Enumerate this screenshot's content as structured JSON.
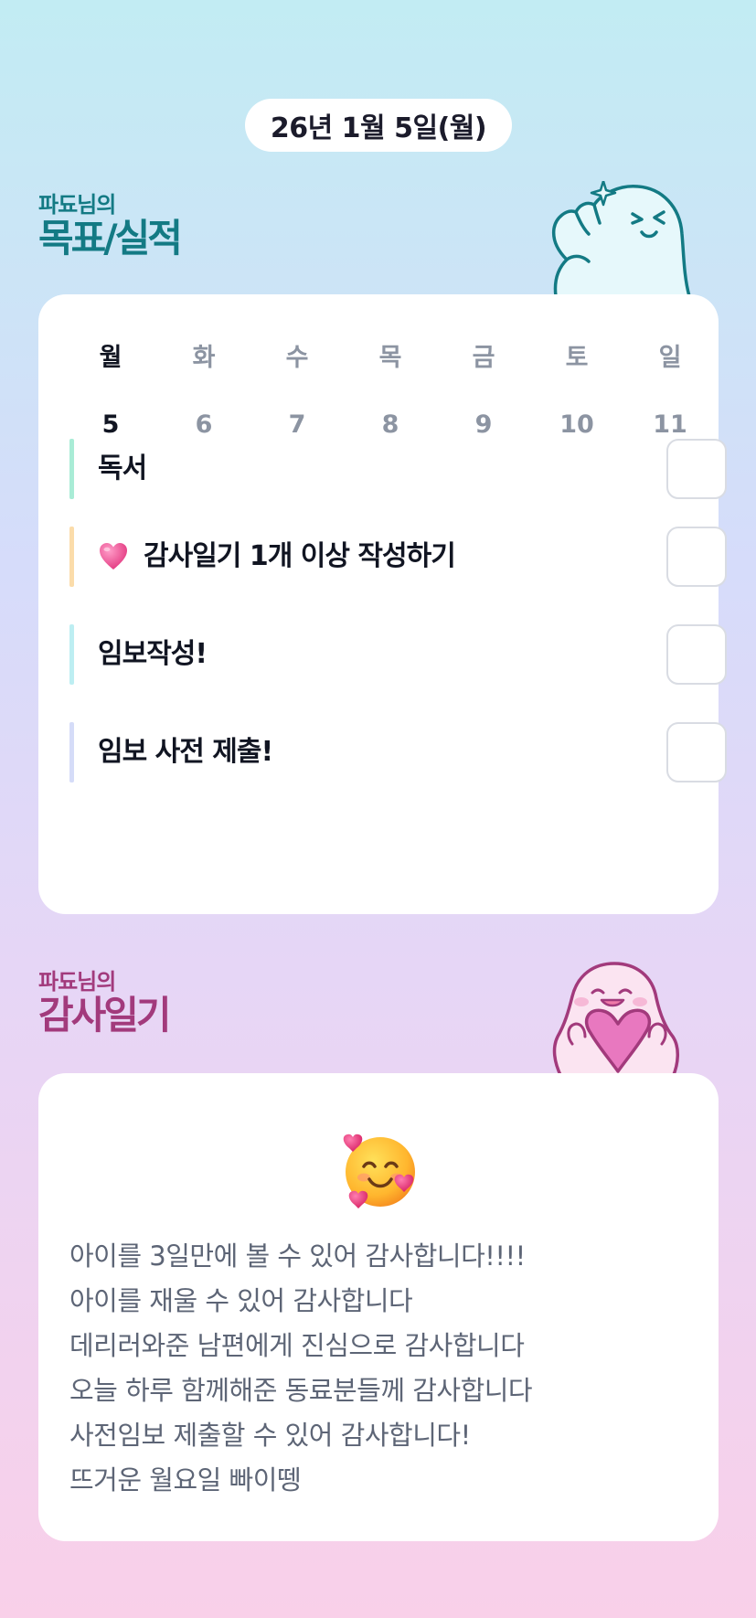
{
  "date": "26년 1월 5일(월)",
  "goal_section": {
    "owner": "파됴님의",
    "title": "목표/실적"
  },
  "week": {
    "days": [
      {
        "weekday": "월",
        "day": "5",
        "active": true
      },
      {
        "weekday": "화",
        "day": "6",
        "active": false
      },
      {
        "weekday": "수",
        "day": "7",
        "active": false
      },
      {
        "weekday": "목",
        "day": "8",
        "active": false
      },
      {
        "weekday": "금",
        "day": "9",
        "active": false
      },
      {
        "weekday": "토",
        "day": "10",
        "active": false
      },
      {
        "weekday": "일",
        "day": "11",
        "active": false
      }
    ]
  },
  "goals": [
    {
      "label": "독서",
      "bar_color": "#a9ecd6",
      "icon": null,
      "checked": false
    },
    {
      "label": "감사일기 1개 이상 작성하기",
      "bar_color": "#fbdcaa",
      "icon": "pink-heart-icon",
      "checked": false
    },
    {
      "label": "임보작성!",
      "bar_color": "#bdeef2",
      "icon": null,
      "checked": false
    },
    {
      "label": "임보 사전 제출!",
      "bar_color": "#d5dcf8",
      "icon": null,
      "checked": false
    }
  ],
  "thanks_section": {
    "owner": "파됴님의",
    "title": "감사일기"
  },
  "thanks_emoji": "smiling-face-with-hearts-icon",
  "thanks_lines": [
    "아이를 3일만에 볼 수 있어 감사합니다!!!!",
    "아이를 재울 수 있어 감사합니다",
    "데리러와준 남편에게 진심으로 감사합니다",
    "오늘 하루 함께해준 동료분들께 감사합니다",
    "사전임보 제출할 수 있어 감사합니다!",
    "뜨거운 월요일 빠이뗑"
  ],
  "colors": {
    "goal_accent": "#137a84",
    "thanks_accent": "#a23a7c",
    "text_dark": "#111522",
    "text_muted": "#8c94a2"
  }
}
